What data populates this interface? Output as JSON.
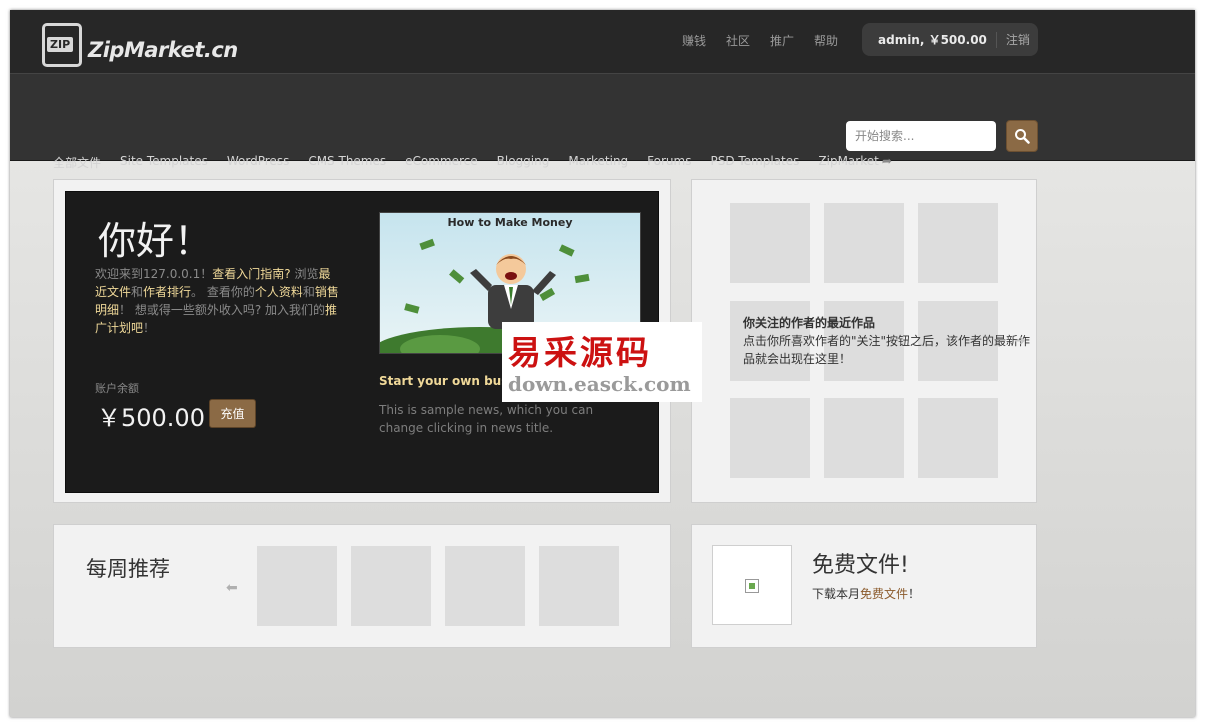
{
  "header": {
    "logo_badge": "ZIP",
    "logo_text": "ZipMarket.cn",
    "links": [
      "赚钱",
      "社区",
      "推广",
      "帮助"
    ],
    "account": "admin, ￥500.00",
    "logout": "注销"
  },
  "nav": {
    "categories": [
      "全部文件",
      "Site Templates",
      "WordPress",
      "CMS Themes",
      "eCommerce",
      "Blogging",
      "Marketing",
      "Forums",
      "PSD Templates",
      "ZipMarket"
    ]
  },
  "search": {
    "placeholder": "开始搜索..."
  },
  "hero": {
    "greeting": "你好！",
    "welcome": {
      "p1": "欢迎来到127.0.0.1！",
      "guide": "查看入门指南?",
      "p2": " 浏览",
      "recent": "最近文件",
      "and": "和",
      "ranking": "作者排行",
      "p3": "。 查看你的",
      "profile": "个人资料",
      "and2": "和",
      "sales": "销售明细",
      "p4": "！ 想或得一些额外收入吗? 加入我们的",
      "affiliate": "推广计划吧",
      "p5": "！"
    },
    "balance_label": "账户余额",
    "balance": "￥500.00",
    "recharge": "充值",
    "news_image_title": "How to Make Money",
    "news_title": "Start your own business",
    "news_desc": "This is sample news, which you can change clicking in news title."
  },
  "follow": {
    "title": "你关注的作者的最近作品",
    "desc": "点击你所喜欢作者的\"关注\"按钮之后，该作者的最新作品就会出现在这里！"
  },
  "weekly": {
    "title": "每周推荐"
  },
  "free": {
    "title": "免费文件!",
    "sub_prefix": "下载本月",
    "sub_link": "免费文件",
    "sub_suffix": "！"
  },
  "watermark": {
    "cn": "易采源码",
    "url": "down.easck.com"
  },
  "colors": {
    "accent": "#8b6a45",
    "highlight": "#f0d999",
    "topbar": "#272727"
  }
}
